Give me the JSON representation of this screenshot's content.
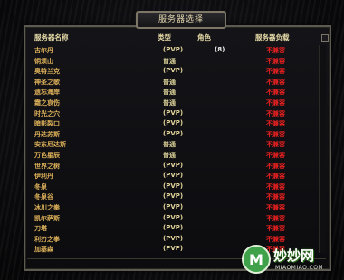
{
  "window": {
    "title": "服务器选择"
  },
  "columns": {
    "name": "服务器名称",
    "type": "类型",
    "role": "角色",
    "status": "服务器负载"
  },
  "servers": [
    {
      "name": "古尔丹",
      "type": "(PVP)",
      "role": "(8)",
      "status": "不兼容"
    },
    {
      "name": "铜须山",
      "type": "普通",
      "role": "",
      "status": "不兼容"
    },
    {
      "name": "奥特兰克",
      "type": "(PVP)",
      "role": "",
      "status": "不兼容"
    },
    {
      "name": "神圣之歌",
      "type": "普通",
      "role": "",
      "status": "不兼容"
    },
    {
      "name": "遗忘海岸",
      "type": "普通",
      "role": "",
      "status": "不兼容"
    },
    {
      "name": "霜之哀伤",
      "type": "普通",
      "role": "",
      "status": "不兼容"
    },
    {
      "name": "时光之穴",
      "type": "(PVP)",
      "role": "",
      "status": "不兼容"
    },
    {
      "name": "暗影裂口",
      "type": "(PVP)",
      "role": "",
      "status": "不兼容"
    },
    {
      "name": "丹达苏斯",
      "type": "(PVP)",
      "role": "",
      "status": "不兼容"
    },
    {
      "name": "安东尼达斯",
      "type": "普通",
      "role": "",
      "status": "不兼容"
    },
    {
      "name": "万色星辰",
      "type": "普通",
      "role": "",
      "status": "不兼容"
    },
    {
      "name": "世界之树",
      "type": "(PVP)",
      "role": "",
      "status": "不兼容"
    },
    {
      "name": "伊利丹",
      "type": "(PVP)",
      "role": "",
      "status": "不兼容"
    },
    {
      "name": "冬泉",
      "type": "(PVP)",
      "role": "",
      "status": "不兼容"
    },
    {
      "name": "冬泉谷",
      "type": "(PVP)",
      "role": "",
      "status": "不兼容"
    },
    {
      "name": "冰川之拳",
      "type": "(PVP)",
      "role": "",
      "status": "不兼容"
    },
    {
      "name": "凯尔萨斯",
      "type": "(PVP)",
      "role": "",
      "status": "不兼容"
    },
    {
      "name": "刀塔",
      "type": "(PVP)",
      "role": "",
      "status": "不兼容"
    },
    {
      "name": "利刃之拳",
      "type": "(PVP)",
      "role": "",
      "status": "不兼容"
    },
    {
      "name": "加基森",
      "type": "(PVP)",
      "role": "",
      "status": "不兼容"
    }
  ],
  "colors": {
    "server_name": "#e0b35a",
    "status_text": "#f02020",
    "frame_border": "#5d5a52"
  },
  "watermark": {
    "text": "妙妙网",
    "subtext": "MIAOMIAO.COM",
    "logo_letter": "M"
  }
}
